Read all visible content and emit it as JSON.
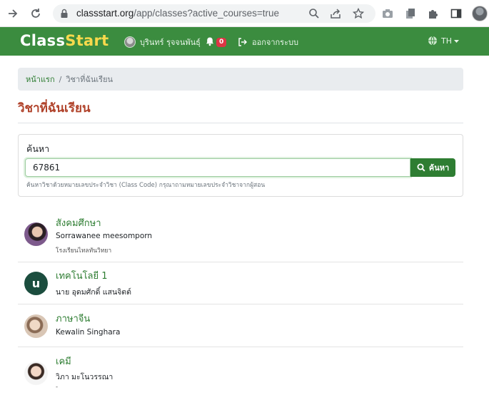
{
  "browser": {
    "url_host": "classstart.org",
    "url_path": "/app/classes?active_courses=true"
  },
  "navbar": {
    "logo_part1": "Class",
    "logo_part2": "Start",
    "user_name": "บุรินทร์ รุจจนพันธุ์",
    "notification_count": "0",
    "logout_label": "ออกจากระบบ",
    "language": "TH"
  },
  "breadcrumb": {
    "home": "หน้าแรก",
    "separator": "/",
    "current": "วิชาที่ฉันเรียน"
  },
  "page": {
    "title": "วิชาที่ฉันเรียน"
  },
  "search": {
    "label": "ค้นหา",
    "value": "67861",
    "button_label": "ค้นหา",
    "help_text": "ค้นหาวิชาด้วยหมายเลขประจำวิชา (Class Code) กรุณาถามหมายเลขประจำวิชาจากผู้สอน"
  },
  "courses": [
    {
      "name": "สังคมศึกษา",
      "teacher": "Sorrawanee meesomporn",
      "school": "โรงเรียนไทลทันวิทยา",
      "avatar_type": "photo"
    },
    {
      "name": "เทคโนโลยี 1",
      "teacher": "นาย อุดมศักดิ์ แสนจิตต์",
      "school": "",
      "avatar_type": "letter",
      "avatar_letter": "u"
    },
    {
      "name": "ภาษาจีน",
      "teacher": "Kewalin Singhara",
      "school": "",
      "avatar_type": "photo"
    },
    {
      "name": "เคมี",
      "teacher": "วิภา มะโนวรรณา",
      "school": "-",
      "avatar_type": "photo"
    }
  ],
  "colors": {
    "navbar": "#3b8c3f",
    "accent_green": "#2e7d32",
    "title_red": "#b0422a",
    "logo_yellow": "#f7d94c"
  }
}
